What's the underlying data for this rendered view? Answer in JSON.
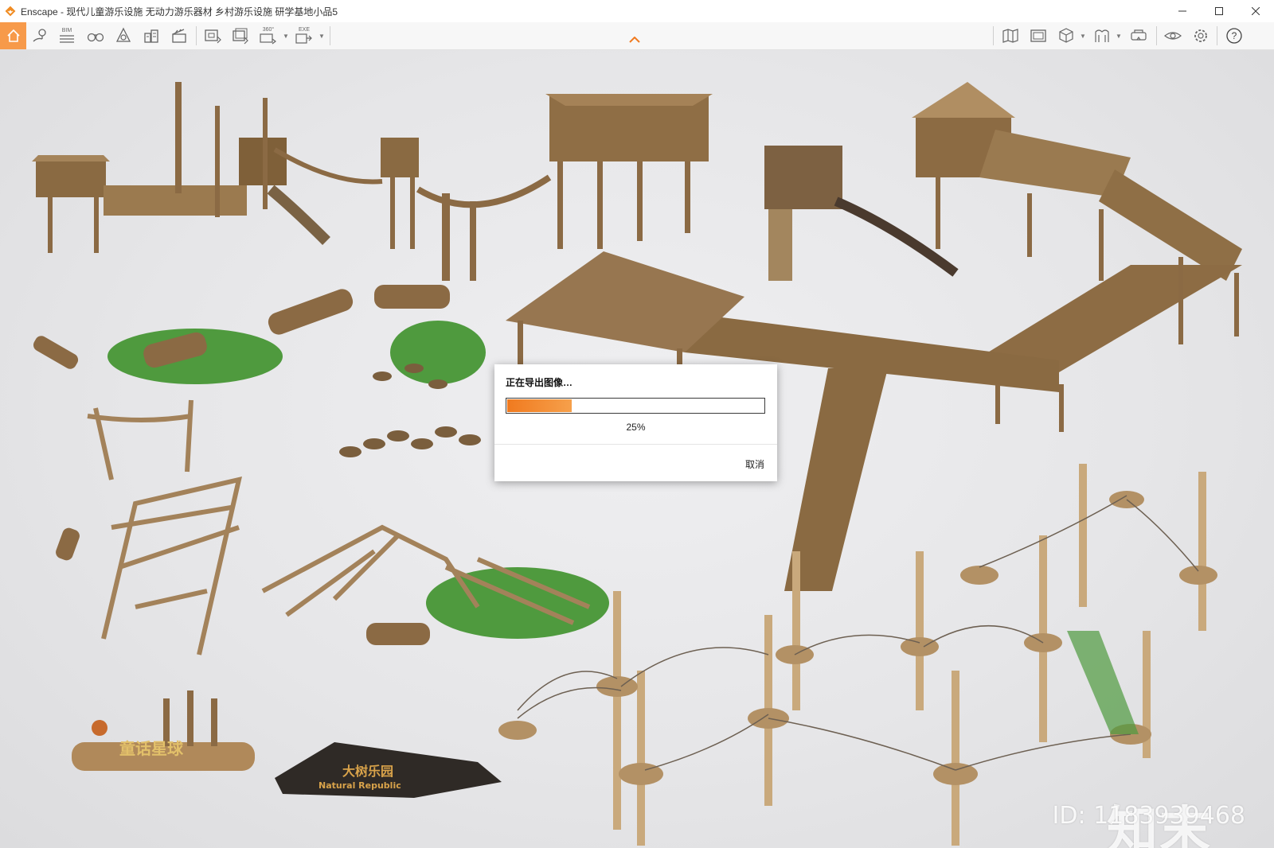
{
  "window": {
    "title": "Enscape - 现代儿童游乐设施 无动力游乐器材 乡村游乐设施 研学基地小品5",
    "controls": [
      "minimize-icon",
      "maximize-icon",
      "close-icon"
    ]
  },
  "toolbar": {
    "left_icons": [
      "home-icon",
      "location-pin-icon",
      "bim-icon",
      "binoculars-icon",
      "asset-library-icon",
      "buildings-icon",
      "clapperboard-icon",
      "screenshot-icon",
      "batch-render-icon",
      "panorama-360-icon",
      "export-exe-icon"
    ],
    "bim_label": "BIM",
    "pano_label": "360°",
    "exe_label": "EXE",
    "right_icons": [
      "map-icon",
      "render-view-icon",
      "cube-view-icon",
      "atlas-icon",
      "vr-headset-icon",
      "eye-icon",
      "settings-gear-icon",
      "help-icon"
    ]
  },
  "dialog": {
    "title": "正在导出图像…",
    "progress": 0.25,
    "percent_text": "25%",
    "cancel_label": "取消",
    "accent": "#f07a1f"
  },
  "scene": {
    "sign_left": "童话星球",
    "sign_right_cn": "大树乐园",
    "sign_right_en": "Natural Republic"
  },
  "watermark": {
    "logo": "知末",
    "id_text": "ID: 1183939468"
  }
}
